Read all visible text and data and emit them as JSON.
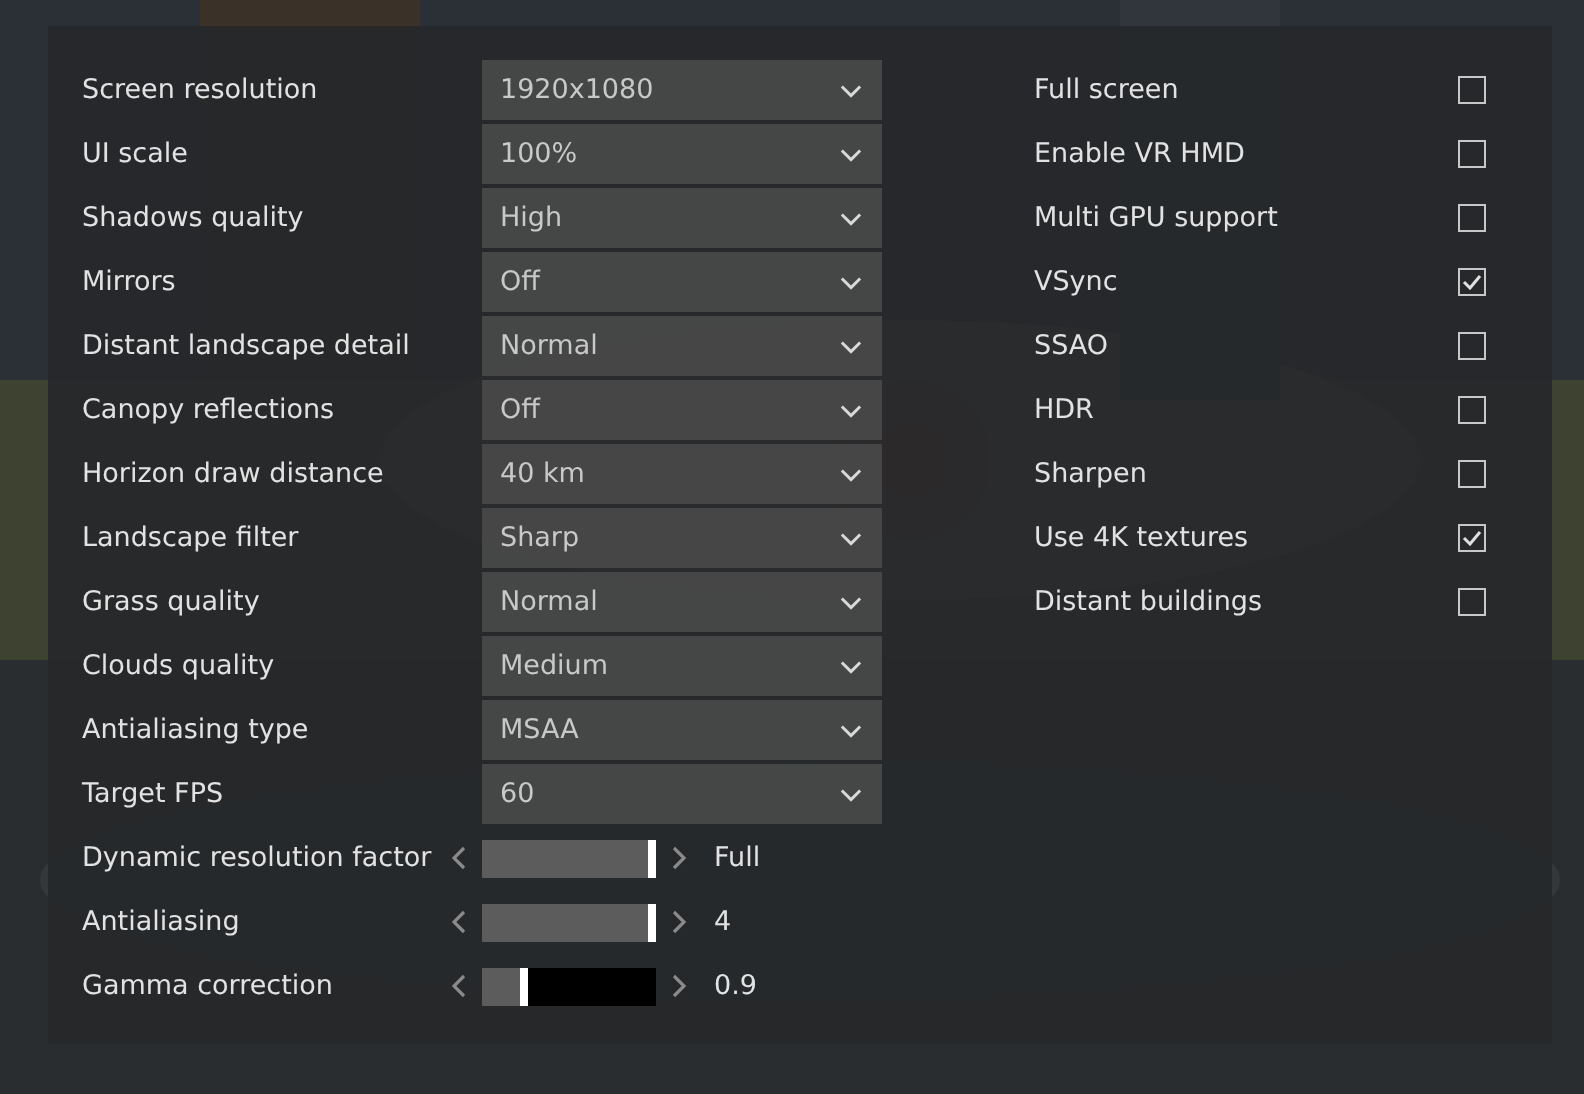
{
  "settings": [
    {
      "kind": "dropdown",
      "label": "Screen resolution",
      "value": "1920x1080"
    },
    {
      "kind": "dropdown",
      "label": "UI scale",
      "value": "100%"
    },
    {
      "kind": "dropdown",
      "label": "Shadows quality",
      "value": "High"
    },
    {
      "kind": "dropdown",
      "label": "Mirrors",
      "value": "Off"
    },
    {
      "kind": "dropdown",
      "label": "Distant landscape detail",
      "value": "Normal"
    },
    {
      "kind": "dropdown",
      "label": "Canopy reflections",
      "value": "Off"
    },
    {
      "kind": "dropdown",
      "label": "Horizon draw distance",
      "value": "40 km"
    },
    {
      "kind": "dropdown",
      "label": "Landscape filter",
      "value": "Sharp"
    },
    {
      "kind": "dropdown",
      "label": "Grass quality",
      "value": "Normal"
    },
    {
      "kind": "dropdown",
      "label": "Clouds quality",
      "value": "Medium"
    },
    {
      "kind": "dropdown",
      "label": "Antialiasing type",
      "value": "MSAA"
    },
    {
      "kind": "dropdown",
      "label": "Target FPS",
      "value": "60"
    },
    {
      "kind": "slider",
      "label": "Dynamic resolution factor",
      "level": 1,
      "reading": "Full"
    },
    {
      "kind": "slider",
      "label": "Antialiasing",
      "level": 1,
      "reading": "4"
    },
    {
      "kind": "slider",
      "label": "Gamma correction",
      "level": 0.26,
      "reading": "0.9"
    }
  ],
  "toggles": [
    {
      "label": "Full screen",
      "checked": false
    },
    {
      "label": "Enable VR HMD",
      "checked": false
    },
    {
      "label": "Multi GPU support",
      "checked": false
    },
    {
      "label": "VSync",
      "checked": true
    },
    {
      "label": "SSAO",
      "checked": false
    },
    {
      "label": "HDR",
      "checked": false
    },
    {
      "label": "Sharpen",
      "checked": false
    },
    {
      "label": "Use 4K textures",
      "checked": true
    },
    {
      "label": "Distant buildings",
      "checked": false
    }
  ]
}
